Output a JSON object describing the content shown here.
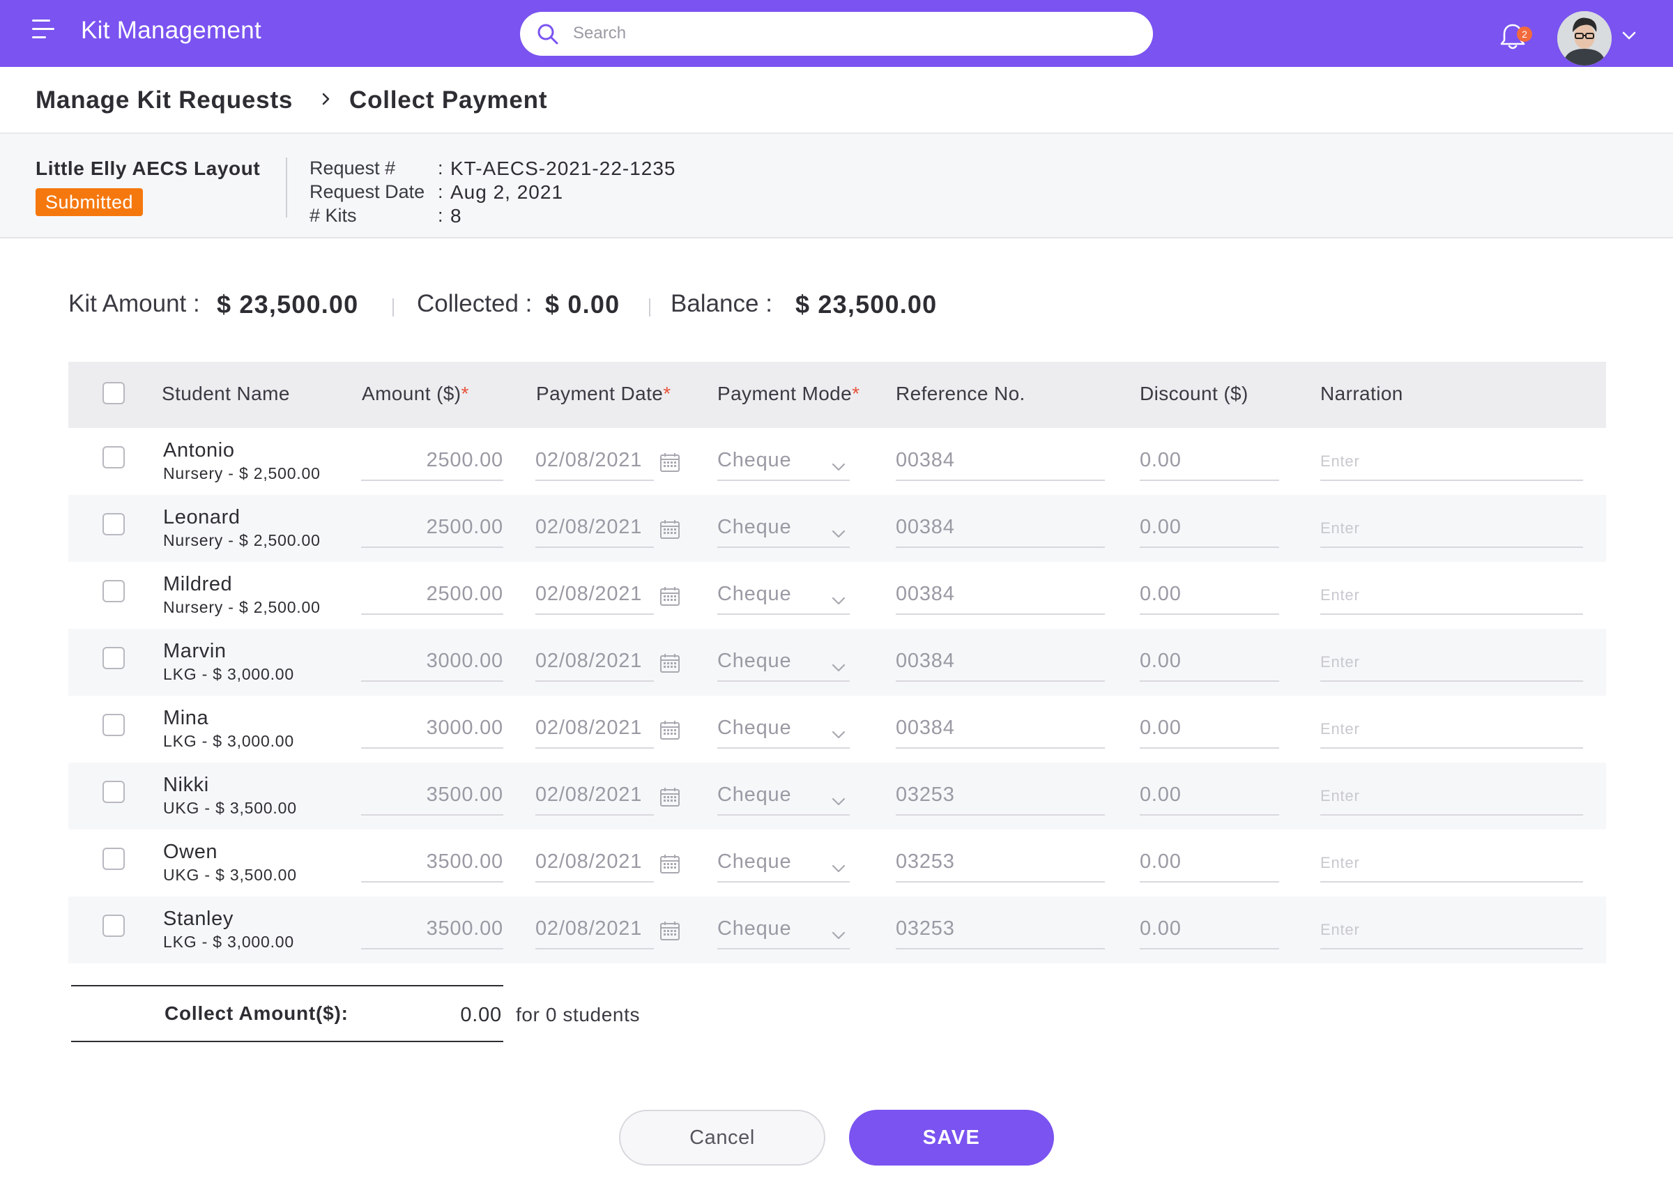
{
  "app": {
    "title": "Kit Management"
  },
  "search": {
    "placeholder": "Search"
  },
  "notifications": {
    "count": "2"
  },
  "breadcrumb": {
    "parent": "Manage Kit Requests",
    "current": "Collect Payment"
  },
  "request": {
    "school": "Little Elly AECS Layout",
    "status": "Submitted",
    "fields": [
      {
        "label": "Request #",
        "value": "KT-AECS-2021-22-1235"
      },
      {
        "label": "Request Date",
        "value": "Aug 2, 2021"
      },
      {
        "label": "# Kits",
        "value": "8"
      }
    ]
  },
  "summary": {
    "kit_amount_label": "Kit Amount :",
    "kit_amount": "$ 23,500.00",
    "collected_label": "Collected :",
    "collected": "$ 0.00",
    "balance_label": "Balance :",
    "balance": "$ 23,500.00"
  },
  "table": {
    "columns": {
      "student": "Student Name",
      "amount": "Amount ($)",
      "date": "Payment Date",
      "mode": "Payment Mode",
      "reference": "Reference No.",
      "discount": "Discount ($)",
      "narration": "Narration"
    },
    "required_mark": "*",
    "narration_placeholder": "Enter",
    "rows": [
      {
        "name": "Antonio",
        "sub": "Nursery - $ 2,500.00",
        "amount": "2500.00",
        "date": "02/08/2021",
        "mode": "Cheque",
        "reference": "00384",
        "discount": "0.00"
      },
      {
        "name": "Leonard",
        "sub": "Nursery - $ 2,500.00",
        "amount": "2500.00",
        "date": "02/08/2021",
        "mode": "Cheque",
        "reference": "00384",
        "discount": "0.00"
      },
      {
        "name": "Mildred",
        "sub": "Nursery - $ 2,500.00",
        "amount": "2500.00",
        "date": "02/08/2021",
        "mode": "Cheque",
        "reference": "00384",
        "discount": "0.00"
      },
      {
        "name": "Marvin",
        "sub": "LKG - $ 3,000.00",
        "amount": "3000.00",
        "date": "02/08/2021",
        "mode": "Cheque",
        "reference": "00384",
        "discount": "0.00"
      },
      {
        "name": "Mina",
        "sub": "LKG - $ 3,000.00",
        "amount": "3000.00",
        "date": "02/08/2021",
        "mode": "Cheque",
        "reference": "00384",
        "discount": "0.00"
      },
      {
        "name": "Nikki",
        "sub": "UKG - $ 3,500.00",
        "amount": "3500.00",
        "date": "02/08/2021",
        "mode": "Cheque",
        "reference": "03253",
        "discount": "0.00"
      },
      {
        "name": "Owen",
        "sub": "UKG - $ 3,500.00",
        "amount": "3500.00",
        "date": "02/08/2021",
        "mode": "Cheque",
        "reference": "03253",
        "discount": "0.00"
      },
      {
        "name": "Stanley",
        "sub": "LKG - $ 3,000.00",
        "amount": "3500.00",
        "date": "02/08/2021",
        "mode": "Cheque",
        "reference": "03253",
        "discount": "0.00"
      }
    ]
  },
  "collect": {
    "label": "Collect Amount($):",
    "value": "0.00",
    "note": "for 0 students"
  },
  "buttons": {
    "cancel": "Cancel",
    "save": "SAVE"
  },
  "colors": {
    "brand": "#7a53f0",
    "status": "#f5780f",
    "required": "#e8533a",
    "badge": "#f26a3c"
  },
  "icons": [
    "menu-icon",
    "search-icon",
    "bell-icon",
    "avatar",
    "chevron-down-icon",
    "chevron-right-icon",
    "calendar-icon"
  ]
}
